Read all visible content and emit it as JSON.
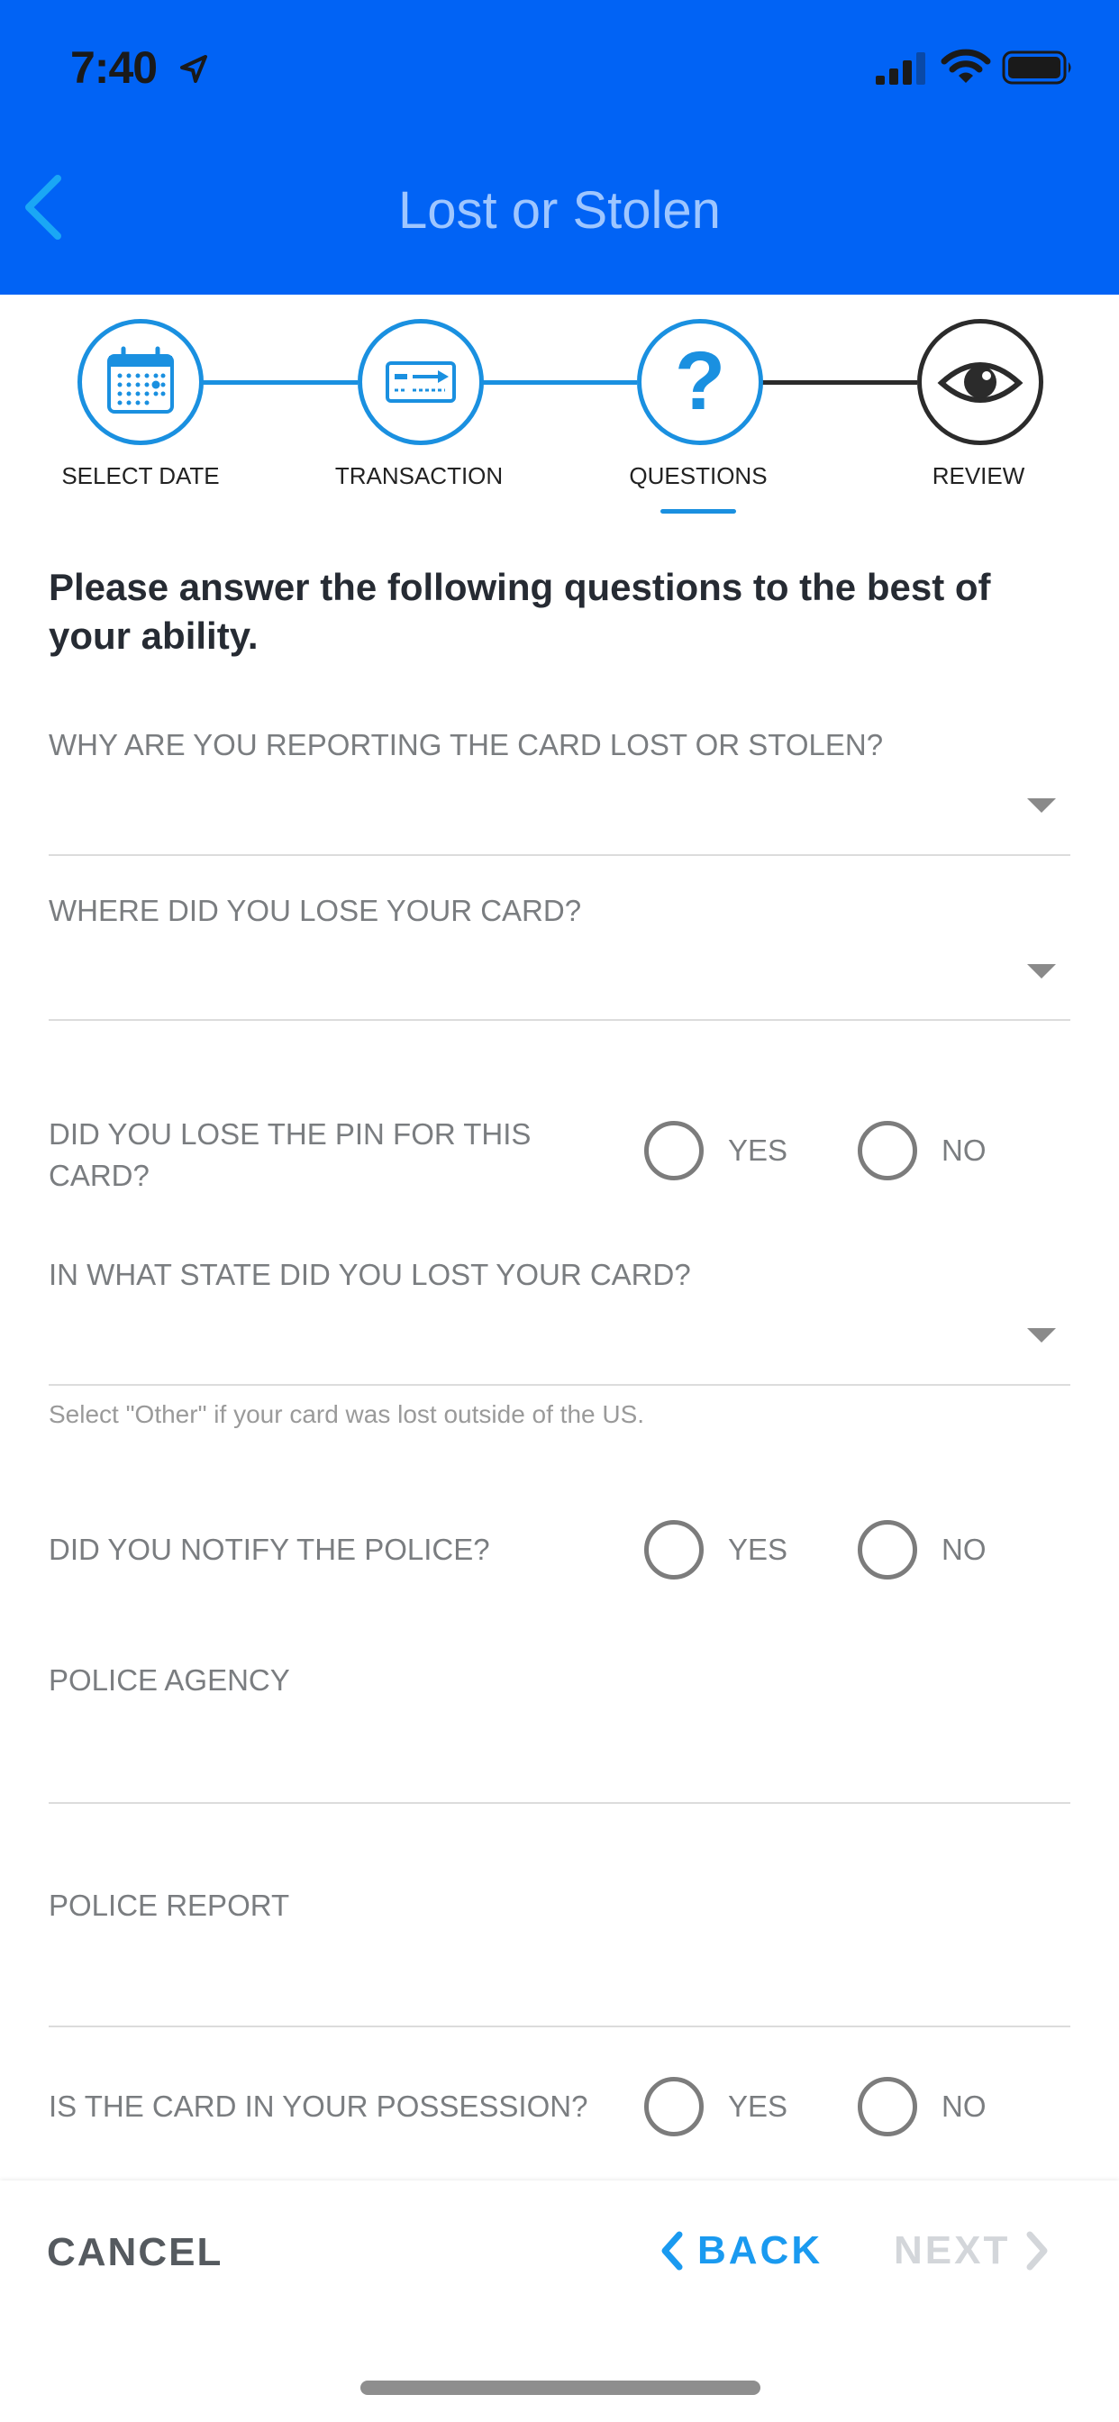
{
  "status_bar": {
    "time": "7:40"
  },
  "header": {
    "title": "Lost or Stolen",
    "back_icon": "chevron-left-icon"
  },
  "colors": {
    "header_bg": "#0163f5",
    "accent": "#1a90e0",
    "title": "#9ec6ff",
    "back": "#1a9af0",
    "disabled": "#d3d6da"
  },
  "stepper": {
    "steps": [
      {
        "label": "SELECT DATE",
        "icon": "calendar-icon",
        "state": "complete"
      },
      {
        "label": "TRANSACTION",
        "icon": "card-icon",
        "state": "complete"
      },
      {
        "label": "QUESTIONS",
        "icon": "question-icon",
        "state": "active"
      },
      {
        "label": "REVIEW",
        "icon": "eye-icon",
        "state": "upcoming"
      }
    ]
  },
  "form": {
    "intro": "Please answer the following questions to the best of your ability.",
    "q_reason": "WHY ARE YOU REPORTING THE CARD LOST OR STOLEN?",
    "q_where": "WHERE DID YOU LOSE YOUR CARD?",
    "q_pin": "DID YOU LOSE THE PIN FOR THIS CARD?",
    "q_state": "IN WHAT STATE DID YOU LOST YOUR CARD?",
    "state_hint": "Select \"Other\" if your card was lost outside of the US.",
    "q_police": "DID YOU NOTIFY THE POLICE?",
    "q_agency": "POLICE AGENCY",
    "q_report": "POLICE REPORT",
    "q_possession": "IS THE CARD IN YOUR POSSESSION?",
    "yes_label": "YES",
    "no_label": "NO"
  },
  "footer": {
    "cancel": "CANCEL",
    "back": "BACK",
    "next": "NEXT"
  }
}
